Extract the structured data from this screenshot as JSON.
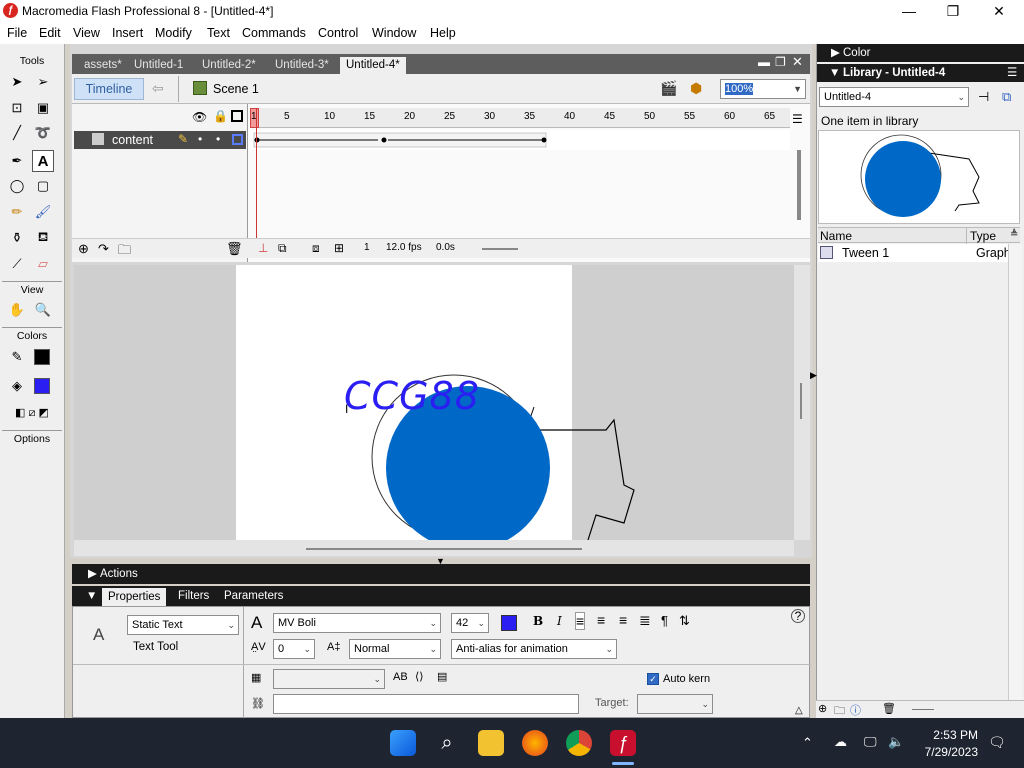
{
  "window": {
    "title": "Macromedia Flash Professional 8 - [Untitled-4*]"
  },
  "menu": [
    "File",
    "Edit",
    "View",
    "Insert",
    "Modify",
    "Text",
    "Commands",
    "Control",
    "Window",
    "Help"
  ],
  "tools": {
    "header": "Tools",
    "view_label": "View",
    "colors_label": "Colors",
    "options_label": "Options"
  },
  "doc_tabs": [
    "assets*",
    "Untitled-1",
    "Untitled-2*",
    "Untitled-3*",
    "Untitled-4*"
  ],
  "editbar": {
    "timeline_label": "Timeline",
    "scene_label": "Scene 1",
    "zoom_value": "100%"
  },
  "timeline": {
    "layer_name": "content",
    "ruler_ticks": [
      "1",
      "5",
      "10",
      "15",
      "20",
      "25",
      "30",
      "35",
      "40",
      "45",
      "50",
      "55",
      "60",
      "65"
    ],
    "current_frame": "1",
    "fps": "12.0 fps",
    "time": "0.0s"
  },
  "stage": {
    "text": "CCG88"
  },
  "panels": {
    "actions": "Actions",
    "tabs": [
      "Properties",
      "Filters",
      "Parameters"
    ]
  },
  "properties": {
    "text_type": "Static Text",
    "tool_name": "Text Tool",
    "font": "MV Boli",
    "font_size": "42",
    "letter_spacing": "0",
    "char_position": "Normal",
    "antialias": "Anti-alias for animation",
    "auto_kern_label": "Auto kern",
    "target_label": "Target:",
    "text_color": "#2b1ef2"
  },
  "right_panel": {
    "color_header": "Color",
    "library_header": "Library - Untitled-4",
    "library_select": "Untitled-4",
    "item_count": "One item in library",
    "col_name": "Name",
    "col_type": "Type",
    "items": [
      {
        "name": "Tween 1",
        "type": "Graph"
      }
    ]
  },
  "taskbar": {
    "time": "2:53 PM",
    "date": "7/29/2023"
  },
  "colors": {
    "circle": "#0069c8",
    "stroke_swatch": "#000000",
    "fill_swatch": "#2b1ef2"
  }
}
